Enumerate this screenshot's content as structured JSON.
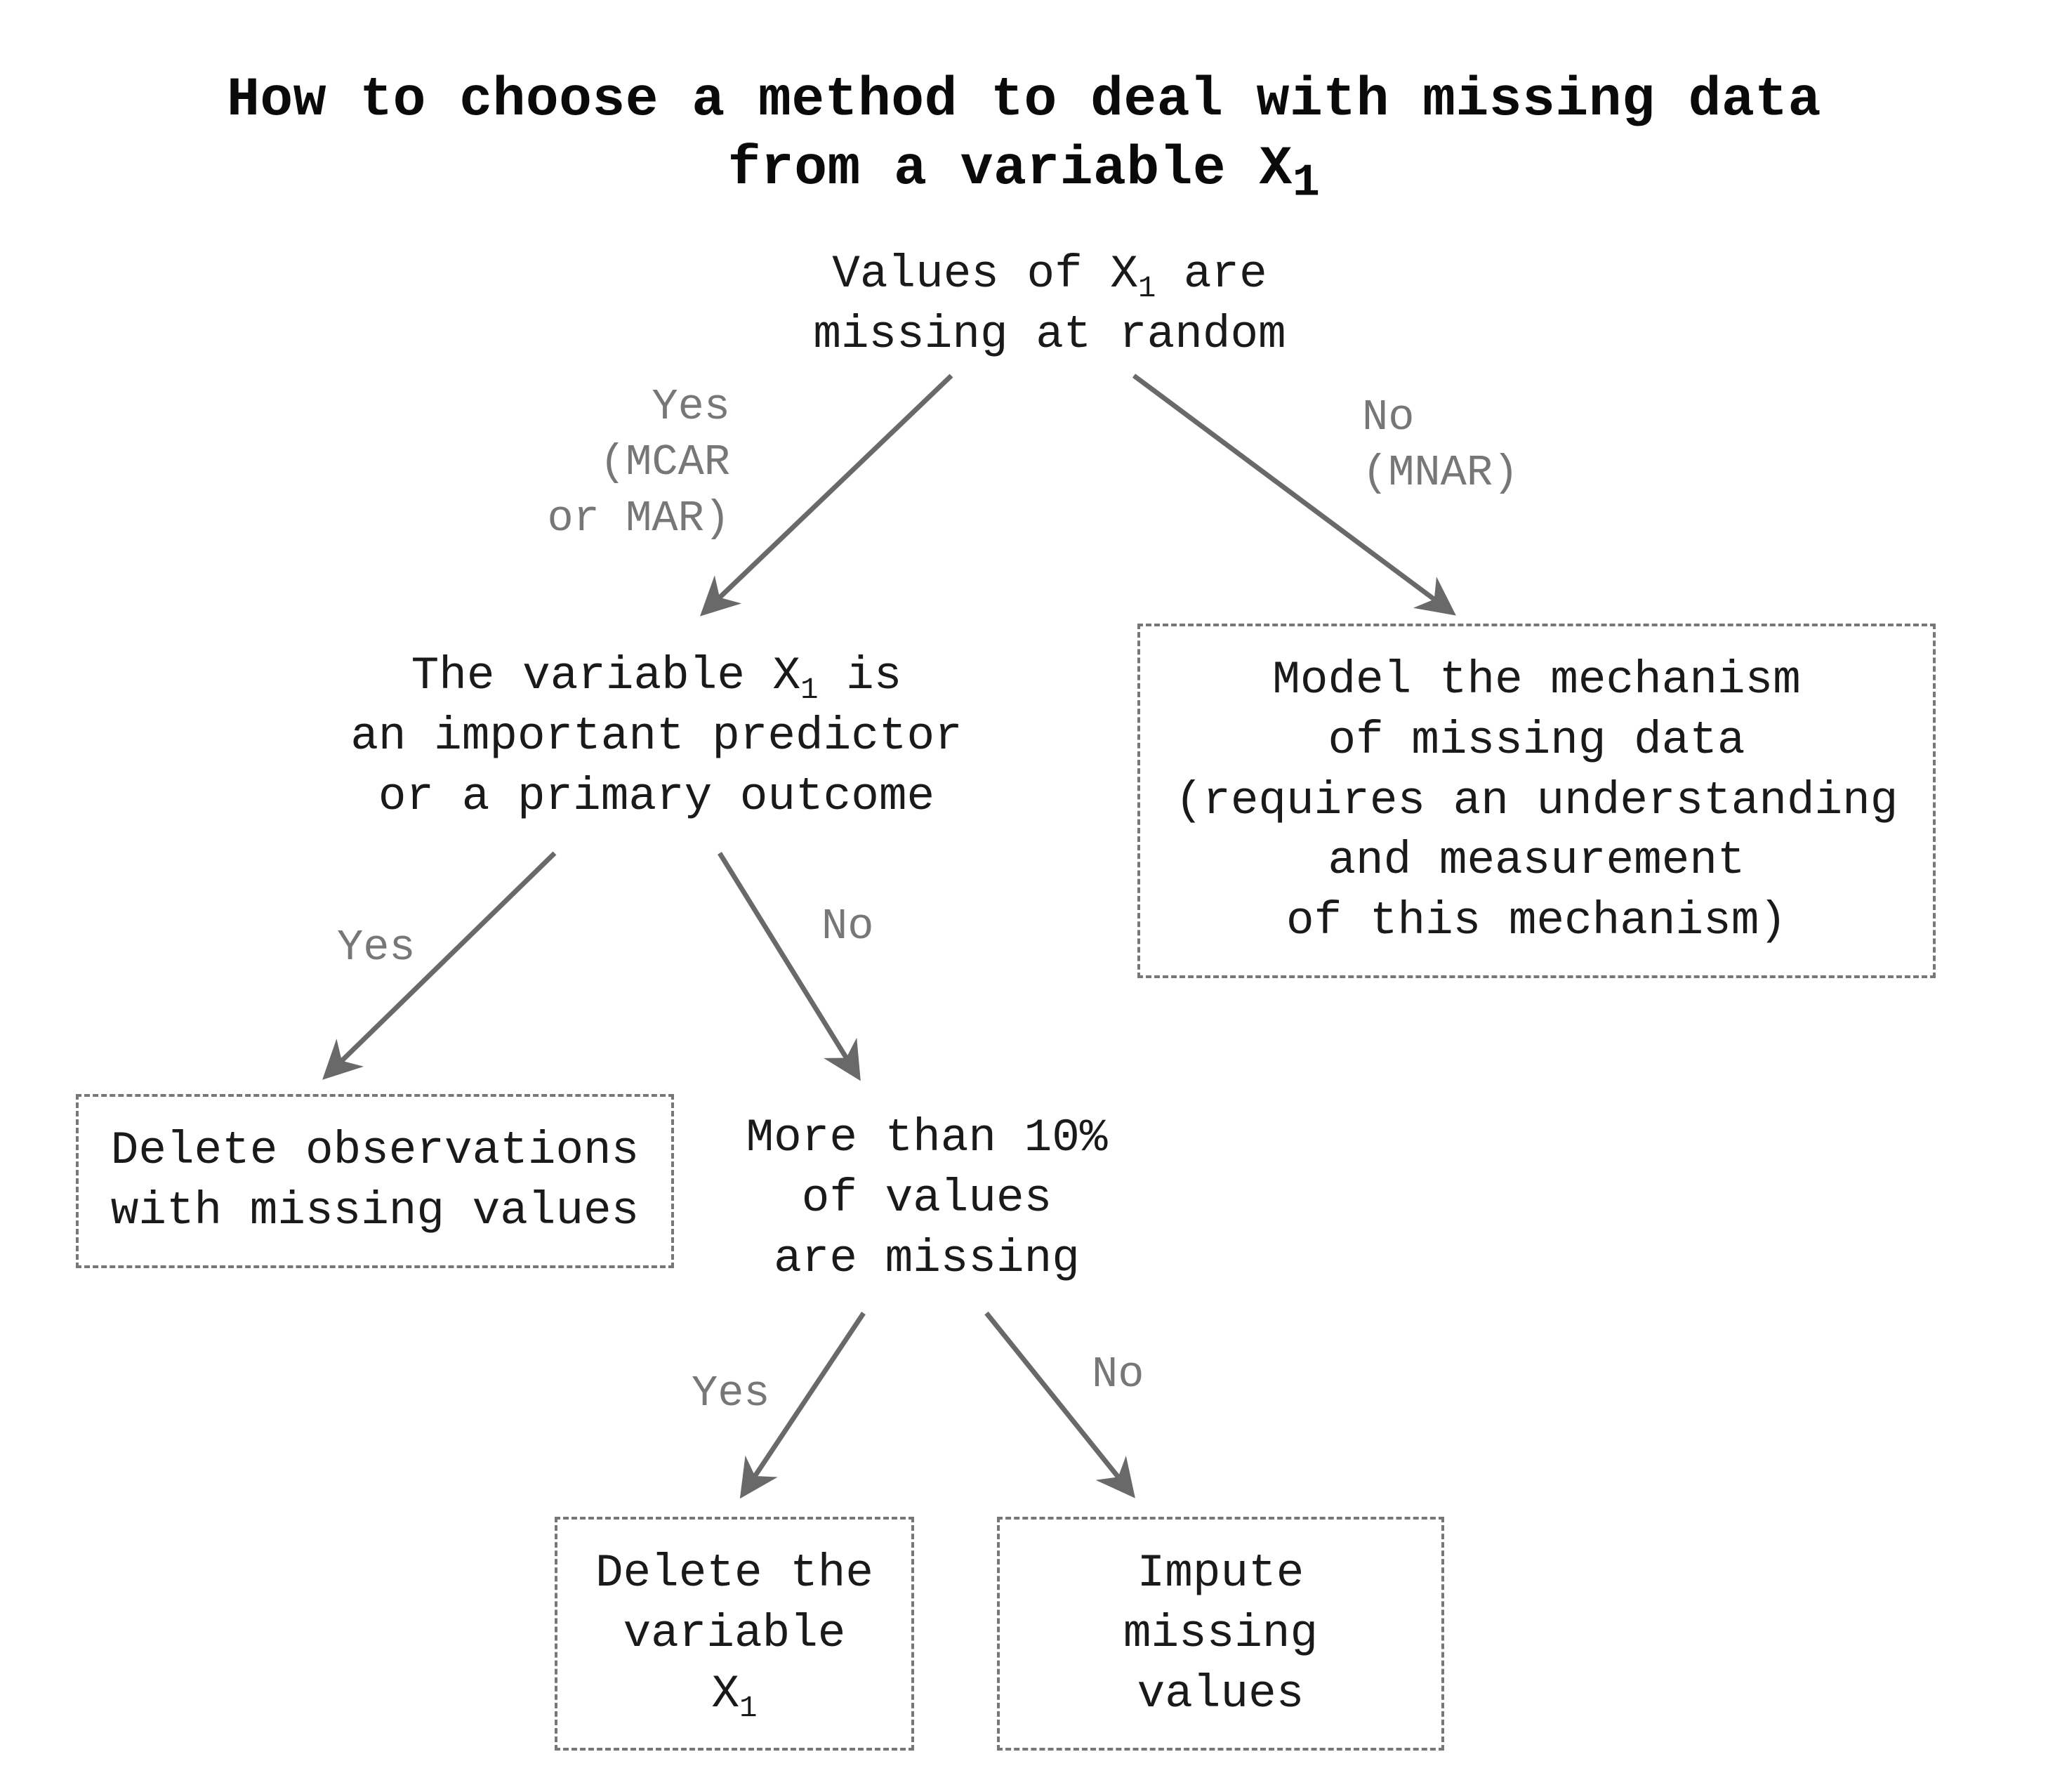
{
  "title_line1": "How to choose a method to deal with missing data",
  "title_line2": "from a variable X",
  "title_sub": "1",
  "nodes": {
    "root_l1": "Values of X",
    "root_sub": "1",
    "root_l1b": " are",
    "root_l2": "missing at random",
    "important_l1a": "The variable X",
    "important_sub": "1",
    "important_l1b": " is",
    "important_l2": "an important predictor",
    "important_l3": "or a primary outcome",
    "model_l1": "Model the mechanism",
    "model_l2": "of missing data",
    "model_l3": "(requires an understanding",
    "model_l4": "and measurement",
    "model_l5": "of this mechanism)",
    "delobs_l1": "Delete observations",
    "delobs_l2": "with missing values",
    "more10_l1": "More than 10%",
    "more10_l2": "of values",
    "more10_l3": "are missing",
    "delvar_l1a": "Delete the",
    "delvar_l2a": "variable X",
    "delvar_sub": "1",
    "impute_l1": "Impute",
    "impute_l2": "missing values"
  },
  "labels": {
    "root_yes_l1": "Yes",
    "root_yes_l2": "(MCAR",
    "root_yes_l3": "or MAR)",
    "root_no_l1": "No",
    "root_no_l2": "(MNAR)",
    "imp_yes": "Yes",
    "imp_no": "No",
    "m10_yes": "Yes",
    "m10_no": "No"
  },
  "colors": {
    "text": "#1a1a1a",
    "muted": "#777777",
    "stroke": "#696969"
  },
  "diagram": {
    "type": "decision-tree",
    "root": "missing_at_random",
    "tree": {
      "missing_at_random": {
        "question": "Values of X1 are missing at random",
        "yes_label": "Yes (MCAR or MAR)",
        "no_label": "No (MNAR)",
        "yes": "important_predictor",
        "no": "model_mechanism"
      },
      "important_predictor": {
        "question": "The variable X1 is an important predictor or a primary outcome",
        "yes_label": "Yes",
        "no_label": "No",
        "yes": "delete_observations",
        "no": "more_than_10pct"
      },
      "more_than_10pct": {
        "question": "More than 10% of values are missing",
        "yes_label": "Yes",
        "no_label": "No",
        "yes": "delete_variable",
        "no": "impute"
      },
      "model_mechanism": {
        "terminal": true,
        "action": "Model the mechanism of missing data (requires an understanding and measurement of this mechanism)"
      },
      "delete_observations": {
        "terminal": true,
        "action": "Delete observations with missing values"
      },
      "delete_variable": {
        "terminal": true,
        "action": "Delete the variable X1"
      },
      "impute": {
        "terminal": true,
        "action": "Impute missing values"
      }
    }
  }
}
